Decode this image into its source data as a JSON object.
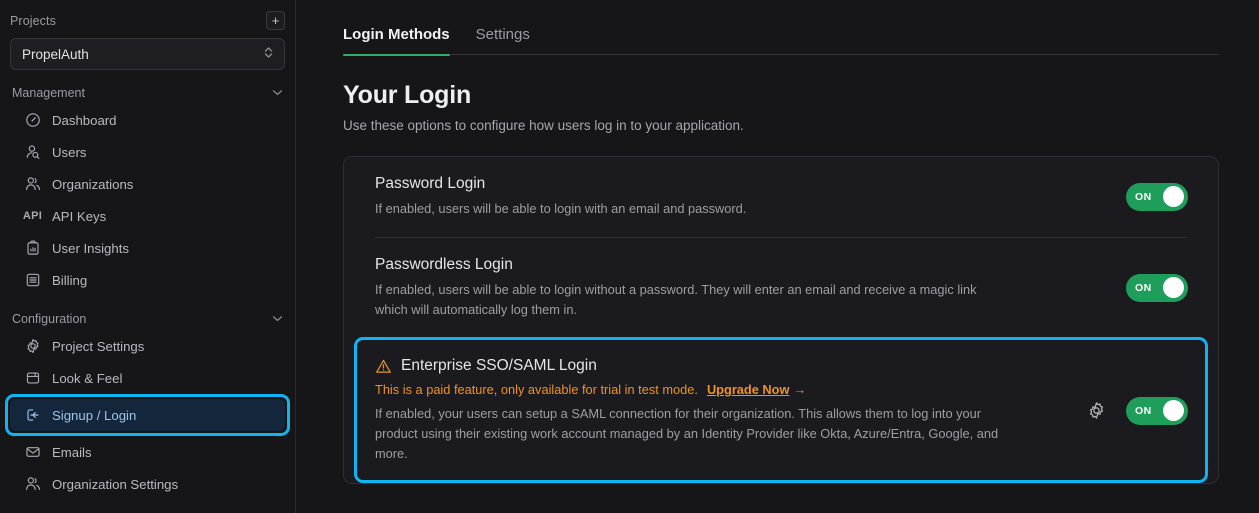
{
  "sidebar": {
    "projects_label": "Projects",
    "add_project_icon": "plus-icon",
    "project_selected": "PropelAuth",
    "groups": [
      {
        "label": "Management",
        "items": [
          {
            "label": "Dashboard",
            "icon": "gauge-icon"
          },
          {
            "label": "Users",
            "icon": "user-search-icon"
          },
          {
            "label": "Organizations",
            "icon": "users-group-icon"
          },
          {
            "label": "API Keys",
            "icon": "api-text-icon"
          },
          {
            "label": "User Insights",
            "icon": "clipboard-chart-icon"
          },
          {
            "label": "Billing",
            "icon": "billing-list-icon"
          }
        ]
      },
      {
        "label": "Configuration",
        "items": [
          {
            "label": "Project Settings",
            "icon": "gear-icon"
          },
          {
            "label": "Look & Feel",
            "icon": "window-icon"
          },
          {
            "label": "Signup / Login",
            "icon": "login-arrow-icon"
          },
          {
            "label": "Emails",
            "icon": "envelope-icon"
          },
          {
            "label": "Organization Settings",
            "icon": "users-group-icon"
          }
        ]
      }
    ]
  },
  "main": {
    "tabs": [
      {
        "label": "Login Methods",
        "active": true
      },
      {
        "label": "Settings",
        "active": false
      }
    ],
    "title": "Your Login",
    "subtitle": "Use these options to configure how users log in to your application.",
    "rows": [
      {
        "title": "Password Login",
        "desc": "If enabled, users will be able to login with an email and password.",
        "toggle": "ON"
      },
      {
        "title": "Passwordless Login",
        "desc": "If enabled, users will be able to login without a password. They will enter an email and receive a magic link which will automatically log them in.",
        "toggle": "ON"
      }
    ],
    "sso": {
      "warning_icon": "warning-triangle-icon",
      "title": "Enterprise SSO/SAML Login",
      "paid_notice": "This is a paid feature, only available for trial in test mode.",
      "upgrade_link": "Upgrade Now",
      "upgrade_arrow": "→",
      "desc": "If enabled, your users can setup a SAML connection for their organization. This allows them to log into your product using their existing work account managed by an Identity Provider like Okta, Azure/Entra, Google, and more.",
      "settings_icon": "gear-icon",
      "toggle": "ON"
    }
  },
  "colors": {
    "accent_green": "#2fab6c",
    "toggle_green": "#1f9d5b",
    "highlight_cyan": "#10b4f0",
    "warning_orange": "#ef9220",
    "selected_bg": "#14263b"
  }
}
